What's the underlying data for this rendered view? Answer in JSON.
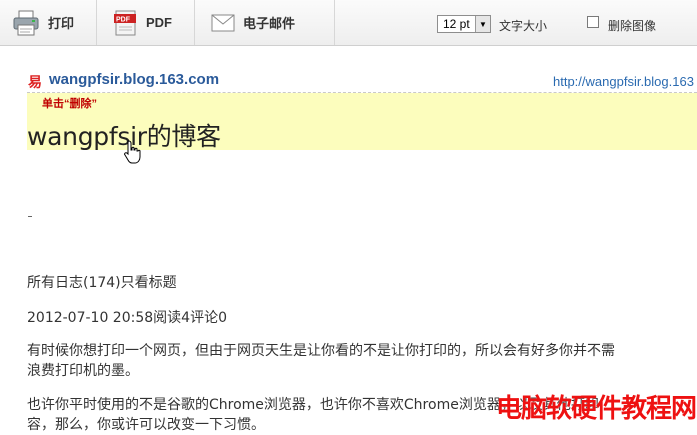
{
  "toolbar": {
    "print_label": "打印",
    "pdf_label": "PDF",
    "email_label": "电子邮件",
    "font_size_value": "12 pt",
    "font_size_label": "文字大小",
    "remove_images_label": "删除图像",
    "remove_images_checked": false
  },
  "page": {
    "site_logo": "易",
    "site_name": "wangpfsir.blog.163.com",
    "site_url": "http://wangpfsir.blog.163",
    "annotation": "单击“删除”",
    "blog_title": "wangpfsir的博客",
    "log_line": "所有日志(174)只看标题",
    "post_meta": "2012-07-10 20:58阅读4评论0",
    "para1_line1": "有时候你想打印一个网页，但由于网页天生是让你看的不是让你打印的，所以会有好多你并不需",
    "para1_line2": "浪费打印机的墨。",
    "para2_line1": "也许你平时使用的不是谷歌的Chrome浏览器，也许你不喜欢Chrome浏览器，以及其他打印",
    "para2_line2": "容，那么，你或许可以改变一下习惯。"
  },
  "watermark": "电脑软硬件教程网",
  "colors": {
    "highlight": "#fcfdbd",
    "annotation": "#c00000",
    "link": "#2a5a9a",
    "watermark": "#ee1111"
  }
}
